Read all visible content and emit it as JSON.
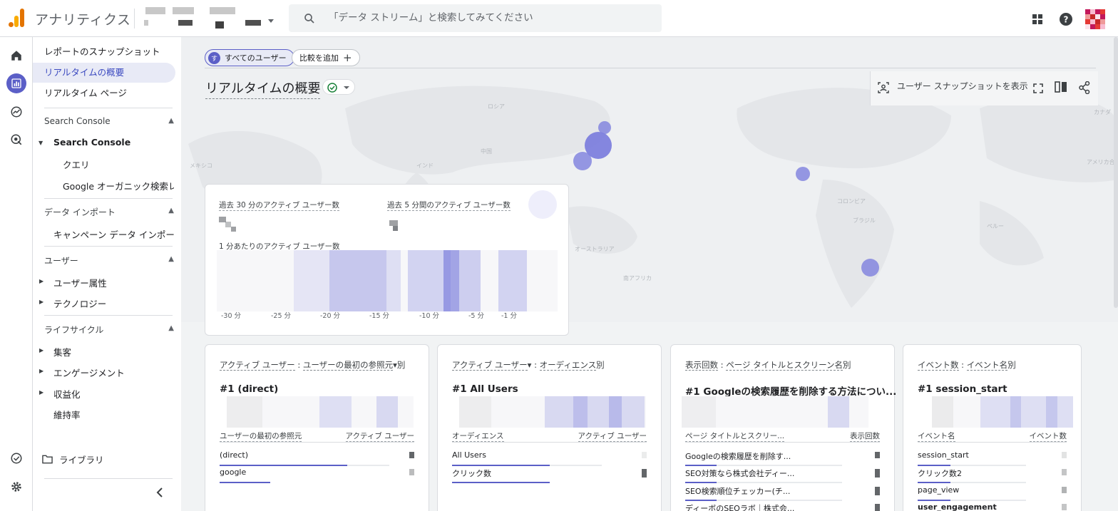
{
  "app": {
    "name": "アナリティクス"
  },
  "search": {
    "placeholder": "「データ ストリーム」と検索してみてください"
  },
  "nav": {
    "snapshot": "レポートのスナップショット",
    "realtime_overview": "リアルタイムの概要",
    "realtime_page": "リアルタイム ページ",
    "sc_section": "Search Console",
    "sc_group": "Search Console",
    "sc_query": "クエリ",
    "sc_organic": "Google オーガニック検索レ...",
    "import_section": "データ インポート",
    "import_campaign": "キャンペーン データ インポー...",
    "user_section": "ユーザー",
    "user_attr": "ユーザー属性",
    "user_tech": "テクノロジー",
    "life_section": "ライフサイクル",
    "life_acq": "集客",
    "life_eng": "エンゲージメント",
    "life_mon": "収益化",
    "life_ret": "維持率",
    "library": "ライブラリ"
  },
  "main": {
    "chip_all_initial": "す",
    "chip_all": "すべてのユーザー",
    "chip_add": "比較を追加",
    "title": "リアルタイムの概要",
    "snapshot_btn": "ユーザー スナップショットを表示"
  },
  "map_labels": [
    "ロシア",
    "カナダ",
    "アメリカ合衆国",
    "メキシコ",
    "ブラジル",
    "オーストラリア",
    "中国",
    "インド",
    "南アフリカ",
    "ペルー",
    "コロンビア"
  ],
  "summary": {
    "active30": "過去 30 分のアクティブ ユーザー数",
    "active5": "過去 5 分間のアクティブ ユーザー数",
    "per_min": "1 分あたりのアクティブ ユーザー数",
    "ticks": [
      "-30 分",
      "-25 分",
      "-20 分",
      "-15 分",
      "-10 分",
      "-5 分",
      "-1 分"
    ]
  },
  "cards": [
    {
      "head_a": "アクティブ ユーザー",
      "head_sep": " : ",
      "head_b": "ユーザーの最初の参照元",
      "head_end": "別",
      "rank": "#1  (direct)",
      "col_l": "ユーザーの最初の参照元",
      "col_r": "アクティブ ユーザー",
      "rows": [
        {
          "name": "(direct)",
          "share": 0.75
        },
        {
          "name": "google",
          "share": 0.3
        }
      ]
    },
    {
      "head_a": "アクティブ ユーザー",
      "head_sep": " : ",
      "head_b": "オーディエンス",
      "head_end": "別",
      "rank": "#1  All Users",
      "col_l": "オーディエンス",
      "col_r": "アクティブ ユーザー",
      "rows": [
        {
          "name": "All Users",
          "share": 0.65
        },
        {
          "name": "クリック数",
          "share": 0.65
        }
      ]
    },
    {
      "head_a": "表示回数",
      "head_sep": " : ",
      "head_b": "ページ タイトルとスクリーン名",
      "head_end": "別",
      "rank": "#1  Googleの検索履歴を削除する方法につい...",
      "col_l": "ページ タイトルとスクリー...",
      "col_r": "表示回数",
      "rows": [
        {
          "name": "Googleの検索履歴を削除す...",
          "share": 0.2
        },
        {
          "name": "SEO対策なら株式会社ディー...",
          "share": 0.2
        },
        {
          "name": "SEO検索順位チェッカー(チ...",
          "share": 0.2
        },
        {
          "name": "ディーボのSEOラボ｜株式会...",
          "share": 0.2
        }
      ]
    },
    {
      "head_a": "イベント数",
      "head_sep": " : ",
      "head_b": "イベント名",
      "head_end": "別",
      "rank": "#1  session_start",
      "col_l": "イベント名",
      "col_r": "イベント数",
      "rows": [
        {
          "name": "session_start",
          "share": 0.3
        },
        {
          "name": "クリック数2",
          "share": 0.3
        },
        {
          "name": "page_view",
          "share": 0.3
        },
        {
          "name": "user_engagement",
          "share": 0.3
        }
      ]
    }
  ],
  "colors": {
    "accent": "#5b5fc7",
    "bubble": "#7d80dd",
    "brand_orange": "#e37400",
    "brand_yellow": "#f9ab00"
  },
  "icons": [
    "search-icon",
    "apps-grid-icon",
    "help-icon",
    "home-icon",
    "reports-icon",
    "explore-icon",
    "advertising-icon",
    "admin-check-icon",
    "settings-gear-icon",
    "folder-icon",
    "collapse-chevron-icon",
    "fullscreen-icon",
    "compare-icon",
    "share-icon",
    "user-snapshot-icon"
  ]
}
